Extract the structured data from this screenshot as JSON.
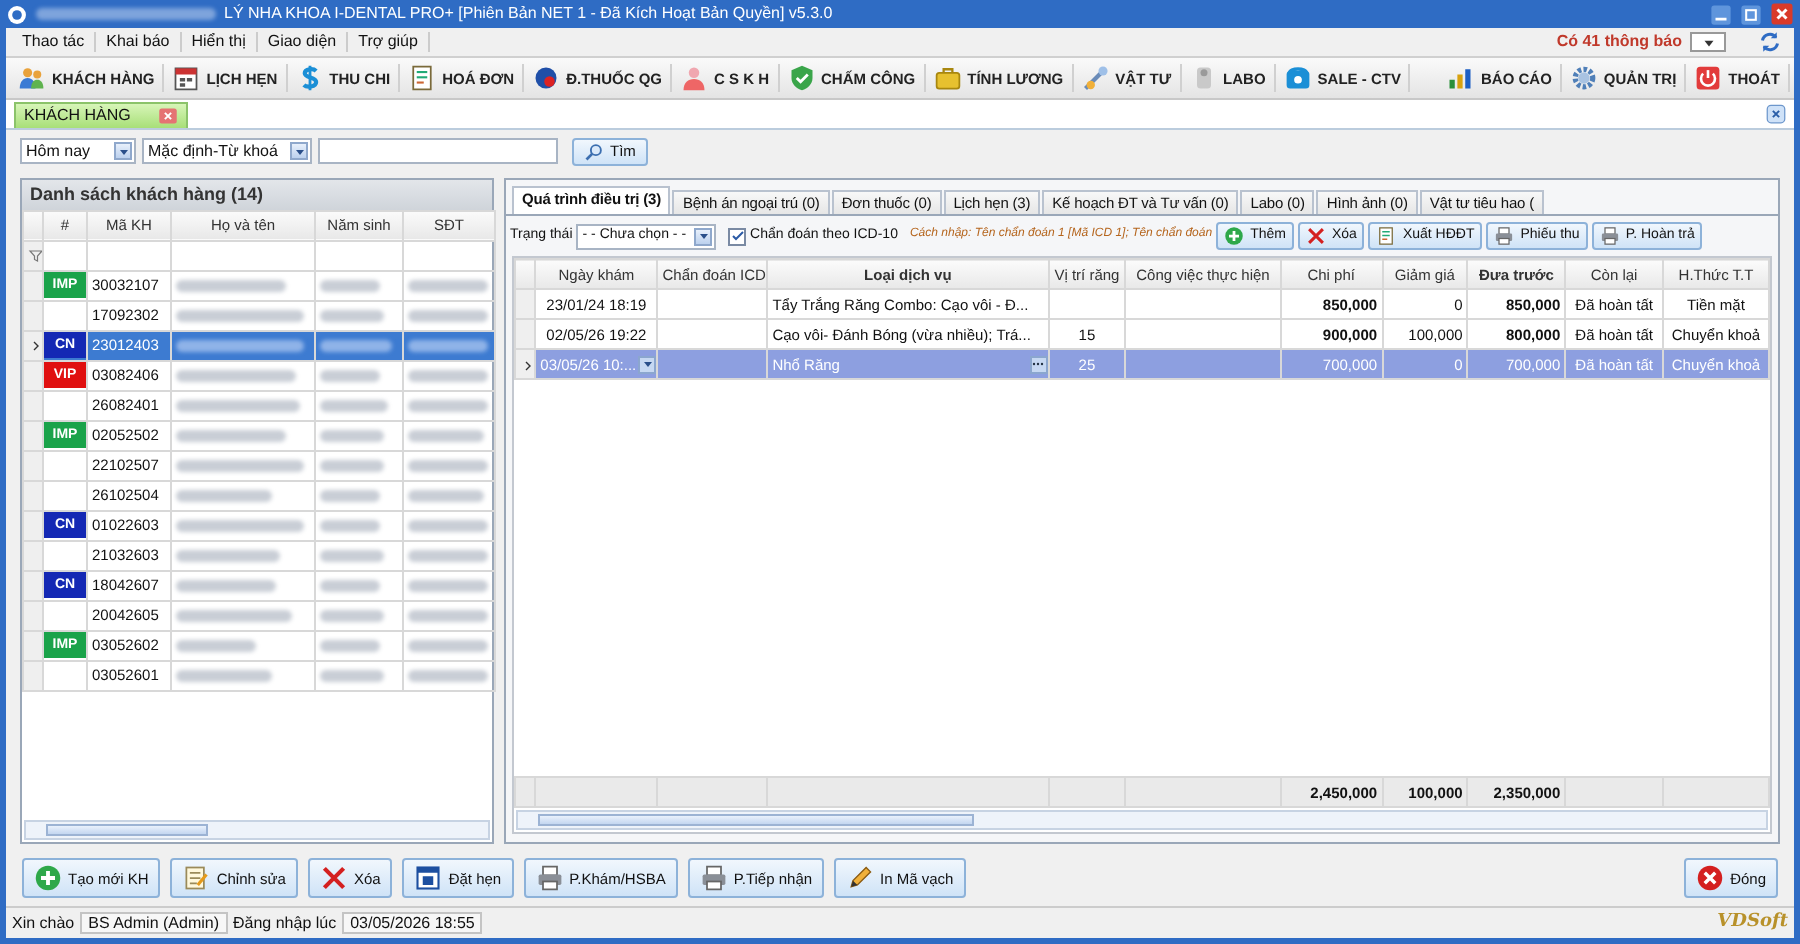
{
  "window": {
    "title": "LÝ NHA KHOA I-DENTAL PRO+ [Phiên Bản NET 1 - Đã Kích Hoạt Bản Quyền] v5.3.0"
  },
  "menu": [
    "Thao tác",
    "Khai báo",
    "Hiển thị",
    "Giao diện",
    "Trợ giúp"
  ],
  "notifications": "Có 41 thông báo",
  "toolbar": [
    "KHÁCH HÀNG",
    "LỊCH HẸN",
    "THU CHI",
    "HOÁ ĐƠN",
    "Đ.THUỐC QG",
    "C S K H",
    "CHẤM CÔNG",
    "TÍNH LƯƠNG",
    "VẬT TƯ",
    "LABO",
    "SALE - CTV"
  ],
  "toolbar_right": [
    "BÁO CÁO",
    "QUẢN TRỊ",
    "THOÁT"
  ],
  "doc_tabs": [
    {
      "label": "KHÁCH HÀNG",
      "selected": true
    }
  ],
  "filter": {
    "period": "Hôm nay",
    "mode": "Mặc định-Từ khoá",
    "search_button": "Tìm"
  },
  "customers": {
    "title": "Danh sách khách hàng (14)",
    "columns": [
      "#",
      "Mã KH",
      "Họ và tên",
      "Năm sinh",
      "SĐT"
    ],
    "rows": [
      {
        "tag": "IMP",
        "color": "#1aa34a",
        "code": "30032107",
        "selected": false
      },
      {
        "code": "17092302",
        "selected": false
      },
      {
        "tag": "CN",
        "color": "#1428b4",
        "code": "23012403",
        "selected": true
      },
      {
        "tag": "VIP",
        "color": "#e01010",
        "code": "03082406",
        "selected": false
      },
      {
        "code": "26082401",
        "selected": false
      },
      {
        "tag": "IMP",
        "color": "#1aa34a",
        "code": "02052502",
        "selected": false
      },
      {
        "code": "22102507",
        "selected": false
      },
      {
        "code": "26102504",
        "selected": false
      },
      {
        "tag": "CN",
        "color": "#1428b4",
        "code": "01022603",
        "selected": false
      },
      {
        "code": "21032603",
        "selected": false
      },
      {
        "tag": "CN",
        "color": "#1428b4",
        "code": "18042607",
        "selected": false
      },
      {
        "code": "20042605",
        "selected": false
      },
      {
        "tag": "IMP",
        "color": "#1aa34a",
        "code": "03052602",
        "selected": false
      },
      {
        "code": "03052601",
        "selected": false
      }
    ]
  },
  "detail_tabs": [
    {
      "label": "Quá trình điều trị (3)",
      "selected": true
    },
    {
      "label": "Bệnh án ngoại trú (0)",
      "selected": false
    },
    {
      "label": "Đơn thuốc (0)",
      "selected": false
    },
    {
      "label": "Lịch hẹn (3)",
      "selected": false
    },
    {
      "label": "Kế hoạch ĐT và Tư vấn (0)",
      "selected": false
    },
    {
      "label": "Labo (0)",
      "selected": false
    },
    {
      "label": "Hình ảnh (0)",
      "selected": false
    },
    {
      "label": "Vật tư tiêu hao (",
      "selected": false
    }
  ],
  "status_filter": {
    "label": "Trạng thái",
    "value": "- - Chưa chọn - -"
  },
  "icd": {
    "label": "Chẩn đoán theo ICD-10",
    "checked": true
  },
  "hint": "Cách nhập: Tên chẩn đoán 1 [Mã ICD 1]; Tên chẩn đoán",
  "actions": [
    "Thêm",
    "Xóa",
    "Xuất HĐĐT",
    "Phiếu thu",
    "P. Hoàn trả"
  ],
  "treatments": {
    "columns": [
      {
        "label": "Ngày khám"
      },
      {
        "label": "Chẩn đoán ICD"
      },
      {
        "label": "Loại dịch vụ",
        "bold": true
      },
      {
        "label": "Vị trí răng"
      },
      {
        "label": "Công việc thực hiện"
      },
      {
        "label": "Chi phí",
        "strong": true,
        "total": "2,450,000"
      },
      {
        "label": "Giảm giá",
        "total": "100,000"
      },
      {
        "label": "Đưa trước",
        "bold": true,
        "strong": true,
        "total": "2,350,000"
      },
      {
        "label": "Còn lại"
      },
      {
        "label": "H.Thức T.T"
      }
    ],
    "rows": [
      {
        "cells": [
          "23/01/24 18:19",
          null,
          "Tẩy Trắng Răng Combo: Cạo vôi - Đ...",
          null,
          null,
          "850,000",
          "0",
          "850,000",
          "Đã hoàn tất",
          "Tiền mặt"
        ],
        "selected": false
      },
      {
        "cells": [
          "02/05/26 19:22",
          null,
          "Cạo vôi- Đánh Bóng (vừa nhiều); Trá...",
          "15",
          null,
          "900,000",
          "100,000",
          "800,000",
          "Đã hoàn tất",
          "Chuyển khoả"
        ],
        "selected": false
      },
      {
        "cells": [
          "03/05/26 10:...",
          null,
          "Nhổ Răng",
          "25",
          null,
          "700,000",
          "0",
          "700,000",
          "Đã hoàn tất",
          "Chuyển khoả"
        ],
        "selected": true
      }
    ]
  },
  "bottom_buttons": [
    "Tạo mới KH",
    "Chỉnh sửa",
    "Xóa",
    "Đặt hẹn",
    "P.Khám/HSBA",
    "P.Tiếp nhận",
    "In Mã vạch"
  ],
  "close_button": "Đóng",
  "status_bar": [
    "Xin chào",
    "BS Admin (Admin)",
    "Đăng nhập lúc",
    "03/05/2026 18:55"
  ],
  "logo": "VDSoft"
}
